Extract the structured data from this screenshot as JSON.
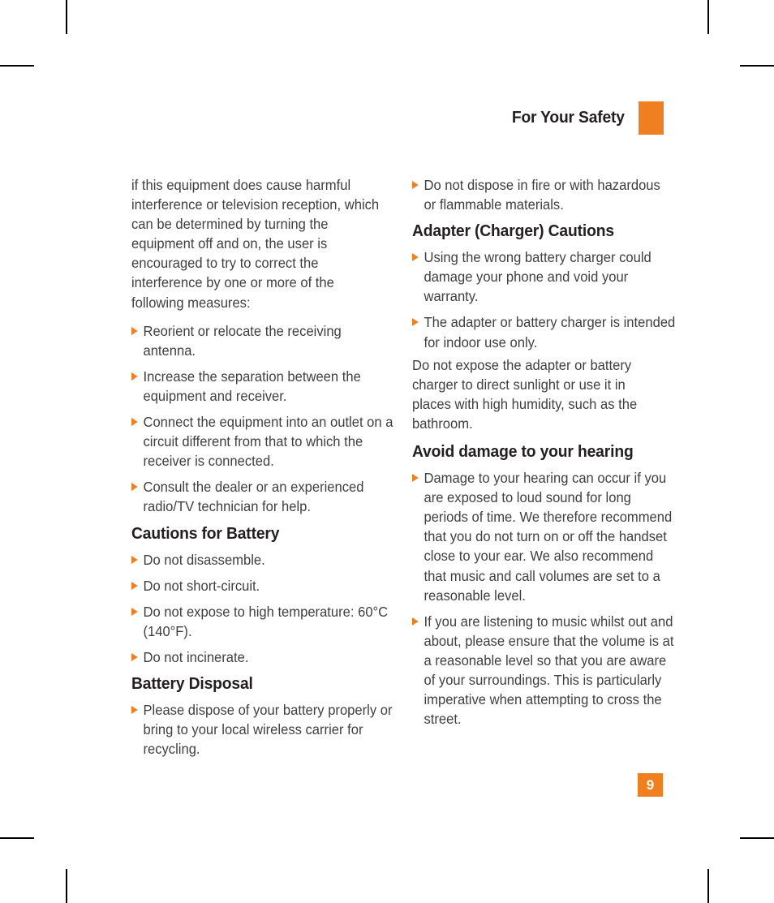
{
  "header": {
    "title": "For Your Safety",
    "accent_color": "#ef7f1f"
  },
  "folio": {
    "page_number": "9"
  },
  "left_column": {
    "intro_paragraph": "if this equipment does cause harmful interference or television reception, which can be determined by turning the equipment off and on, the user is encouraged to try to correct the interference by one or more of the following measures:",
    "measures": [
      "Reorient or relocate the receiving antenna.",
      "Increase the separation between the equipment and receiver.",
      "Connect the equipment into an outlet on a circuit different from that to which the receiver is connected.",
      "Consult the dealer or an experienced radio/TV technician for help."
    ],
    "cautions_heading": "Cautions for Battery",
    "cautions": [
      "Do not disassemble.",
      "Do not short-circuit.",
      "Do not expose to high temperature: 60°C (140°F).",
      "Do not incinerate."
    ],
    "disposal_heading": "Battery Disposal",
    "disposal": [
      "Please dispose of your battery properly or bring to your local wireless carrier for recycling."
    ]
  },
  "right_column": {
    "cautions_continued": [
      "Do not dispose in fire or with hazardous or flammable materials."
    ],
    "adapter_heading": "Adapter (Charger) Cautions",
    "adapter_bullets": [
      "Using the wrong battery charger could damage your phone and void your warranty.",
      "The adapter or battery charger is intended for indoor use only."
    ],
    "adapter_paragraph": "Do not expose the adapter or battery charger to direct sunlight or use it in places with high humidity, such as the bathroom.",
    "hearing_heading": "Avoid damage to your hearing",
    "hearing_bullets": [
      "Damage to your hearing can occur if you are exposed to loud sound for long periods of time. We therefore recommend that you do not turn on or off the handset close to your ear. We also recommend that music and call volumes are set to a reasonable level.",
      "If you are listening to music whilst out and about, please ensure that the volume is at a reasonable level so that you are aware of your surroundings. This is particularly imperative when attempting to cross the street."
    ]
  }
}
